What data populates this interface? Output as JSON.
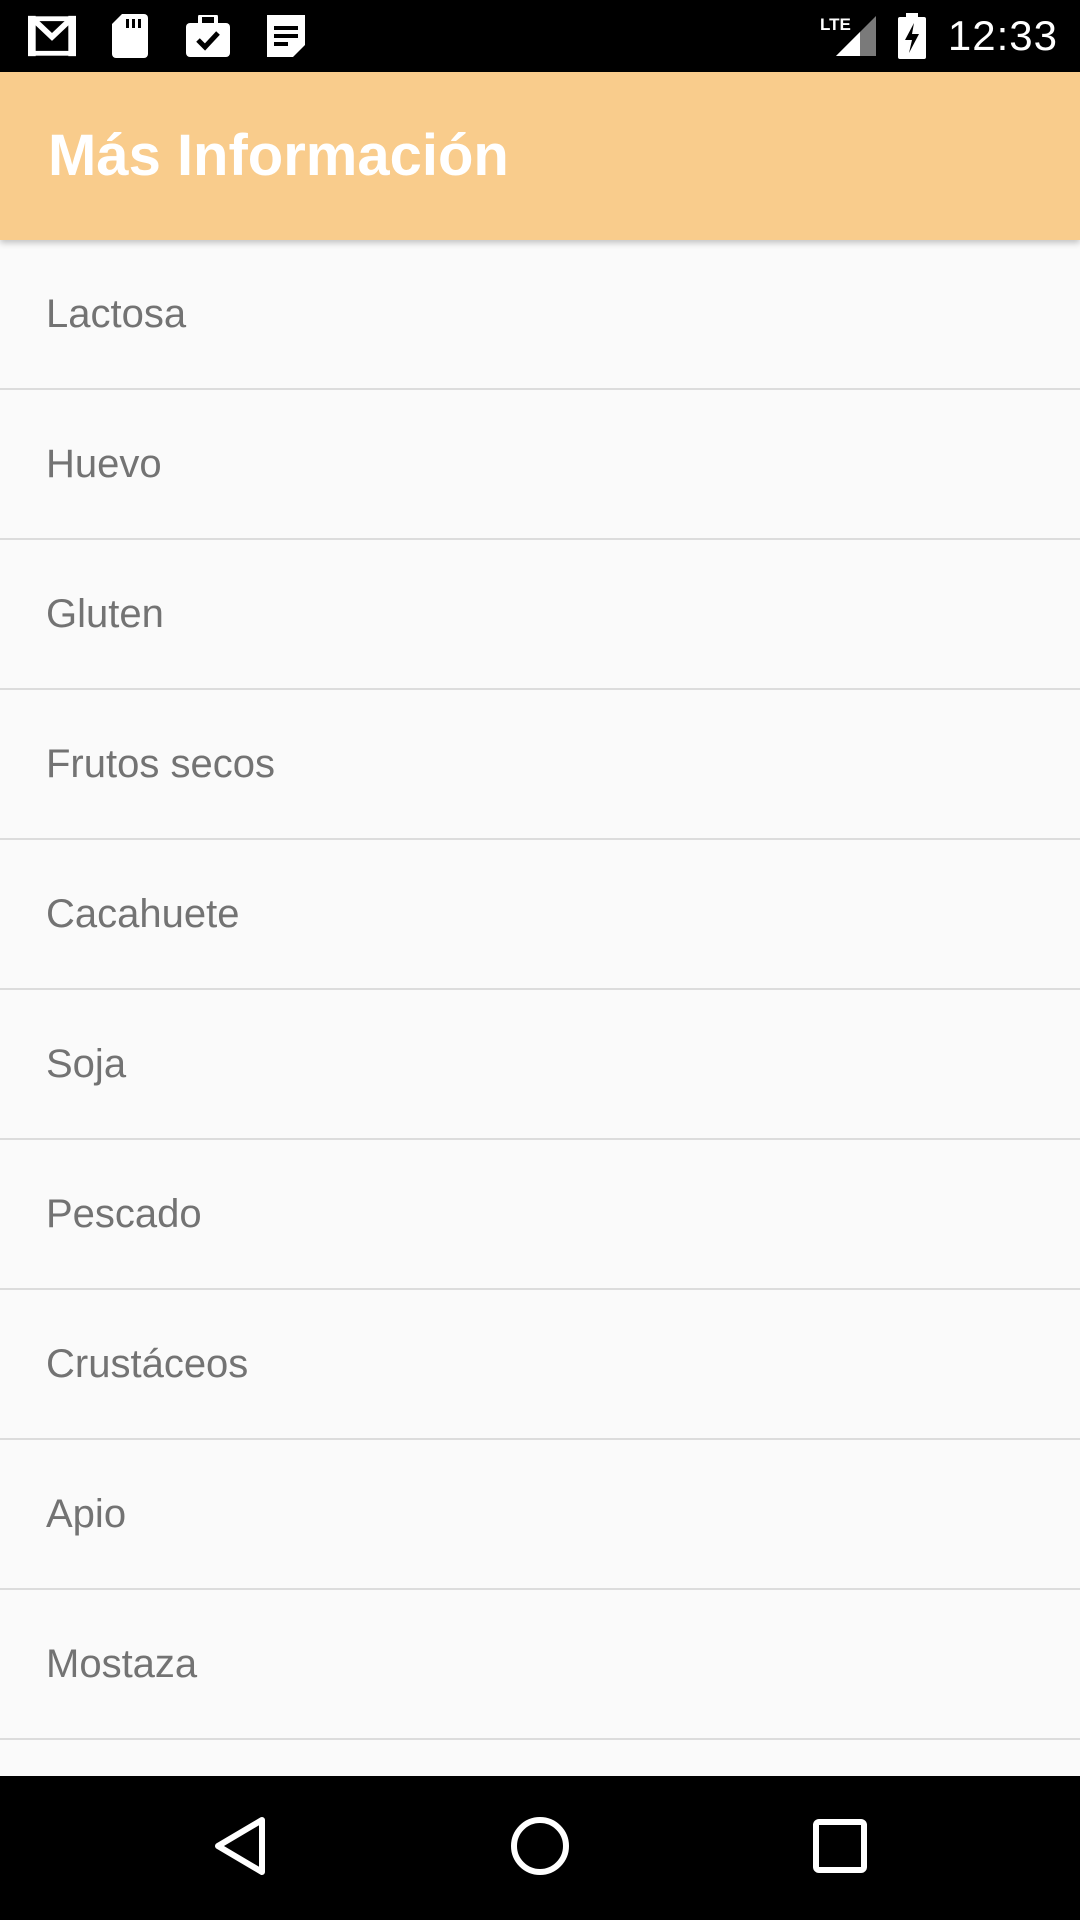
{
  "status_bar": {
    "time": "12:33",
    "network": "LTE",
    "left_icons": [
      "gmail-icon",
      "sd-card-icon",
      "briefcase-check-icon",
      "notes-icon"
    ],
    "right_icons": [
      "lte-signal-icon",
      "battery-charging-icon"
    ]
  },
  "app_bar": {
    "title": "Más Información",
    "color": "#f9cc8c"
  },
  "list": {
    "items": [
      {
        "label": "Lactosa"
      },
      {
        "label": "Huevo"
      },
      {
        "label": "Gluten"
      },
      {
        "label": "Frutos secos"
      },
      {
        "label": "Cacahuete"
      },
      {
        "label": "Soja"
      },
      {
        "label": "Pescado"
      },
      {
        "label": "Crustáceos"
      },
      {
        "label": "Apio"
      },
      {
        "label": "Mostaza"
      }
    ]
  },
  "nav_bar": {
    "buttons": [
      "back-icon",
      "home-icon",
      "recents-icon"
    ]
  }
}
